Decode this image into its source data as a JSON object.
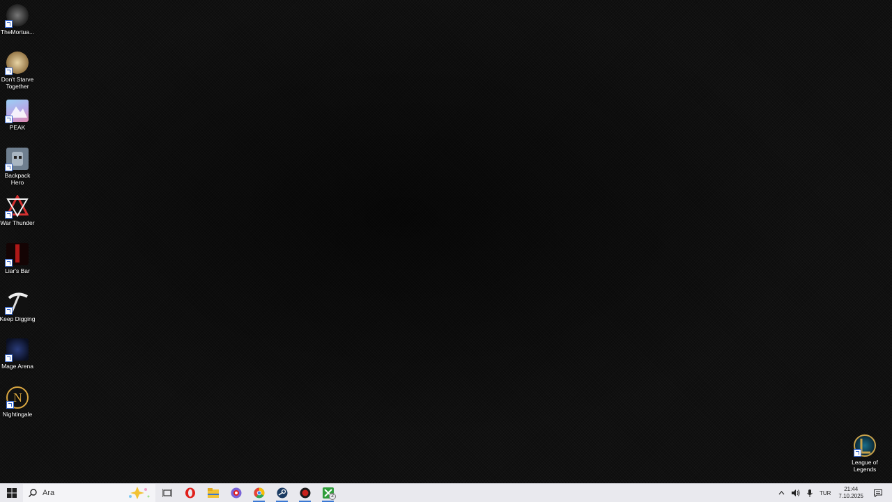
{
  "desktop": {
    "icons": [
      {
        "label": "TheMortua...",
        "icon": "mortuary-icon",
        "color": "#3b3b3b"
      },
      {
        "label": "Don't Starve Together",
        "icon": "dont-starve-icon",
        "color": "#c8a96a"
      },
      {
        "label": "PEAK",
        "icon": "peak-icon",
        "color": "#b6a6e6"
      },
      {
        "label": "Backpack Hero",
        "icon": "backpack-hero-icon",
        "color": "#7a8a9a"
      },
      {
        "label": "War Thunder",
        "icon": "war-thunder-icon",
        "color": "#d43030"
      },
      {
        "label": "Liar's Bar",
        "icon": "liars-bar-icon",
        "color": "#b01818"
      },
      {
        "label": "Keep Digging",
        "icon": "keep-digging-icon",
        "color": "#e0e0e0"
      },
      {
        "label": "Mage Arena",
        "icon": "mage-arena-icon",
        "color": "#1a2a5a"
      },
      {
        "label": "Nightingale",
        "icon": "nightingale-icon",
        "color": "#d7a540"
      },
      {
        "label": "League of Legends",
        "icon": "league-of-legends-icon",
        "color": "#c9a24b"
      }
    ]
  },
  "taskbar": {
    "search_placeholder": "Ara",
    "apps": [
      {
        "name": "task-view-icon",
        "color": "#333333"
      },
      {
        "name": "opera-icon",
        "color": "#e0201b"
      },
      {
        "name": "file-explorer-icon",
        "color": "#f2c233"
      },
      {
        "name": "discord-like-icon",
        "color": "#7a63d8"
      },
      {
        "name": "chrome-icon",
        "color": "#34a853"
      },
      {
        "name": "steam-icon",
        "color": "#1b3b63"
      },
      {
        "name": "red-app-icon",
        "color": "#c8201a"
      },
      {
        "name": "xbox-icon",
        "color": "#2f9e3a"
      }
    ],
    "xbox_badge": "2",
    "tray": {
      "language": "TUR",
      "time": "21:44",
      "date": "7.10.2025"
    }
  }
}
